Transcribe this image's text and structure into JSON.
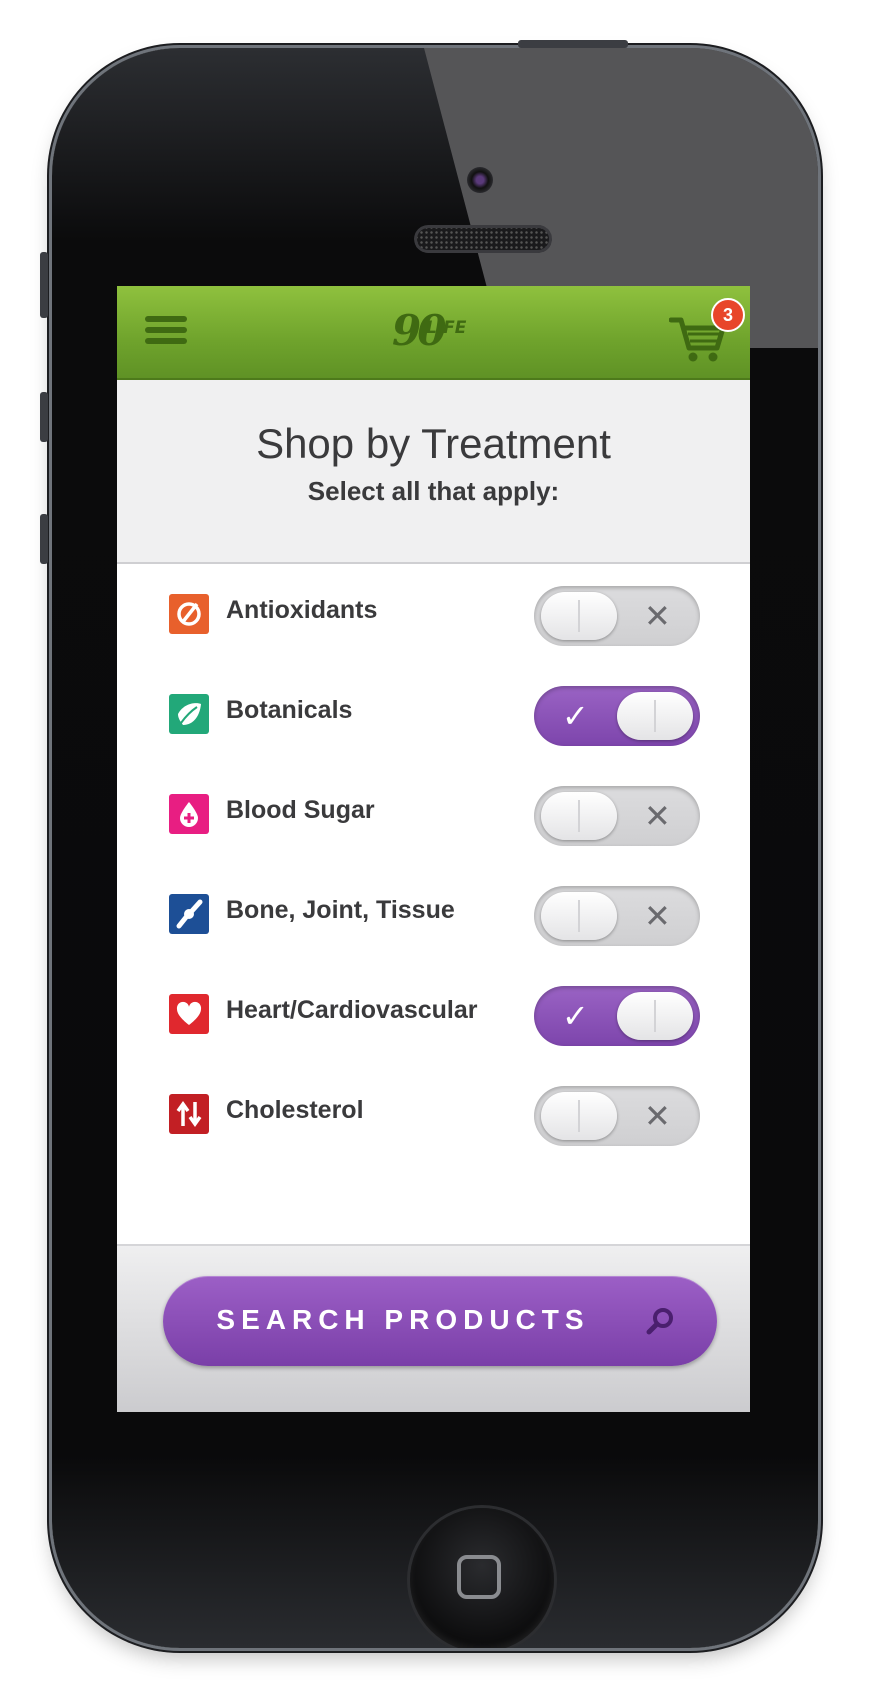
{
  "app": {
    "logo_text_number": "90",
    "logo_text_word": "LIFE",
    "cart_count": "3"
  },
  "header": {
    "title": "Shop by Treatment",
    "subtitle": "Select all that apply:"
  },
  "treatments": [
    {
      "label": "Antioxidants",
      "icon": "antioxidant-icon",
      "icon_color": "#e8602c",
      "selected": false
    },
    {
      "label": "Botanicals",
      "icon": "leaf-icon",
      "icon_color": "#22a879",
      "selected": true
    },
    {
      "label": "Blood Sugar",
      "icon": "blood-drop-icon",
      "icon_color": "#e81e82",
      "selected": false
    },
    {
      "label": "Bone, Joint, Tissue",
      "icon": "bone-joint-icon",
      "icon_color": "#1d4f96",
      "selected": false
    },
    {
      "label": "Heart/Cardiovascular",
      "icon": "heart-icon",
      "icon_color": "#e0282e",
      "selected": true
    },
    {
      "label": "Cholesterol",
      "icon": "up-down-arrows-icon",
      "icon_color": "#c21f24",
      "selected": false
    }
  ],
  "toggle_marks": {
    "on": "✓",
    "off": "✕"
  },
  "footer": {
    "search_label": "SEARCH PRODUCTS"
  },
  "colors": {
    "topbar_green": "#7aae33",
    "accent_purple": "#8a4fb8",
    "badge_red": "#e8462a"
  }
}
